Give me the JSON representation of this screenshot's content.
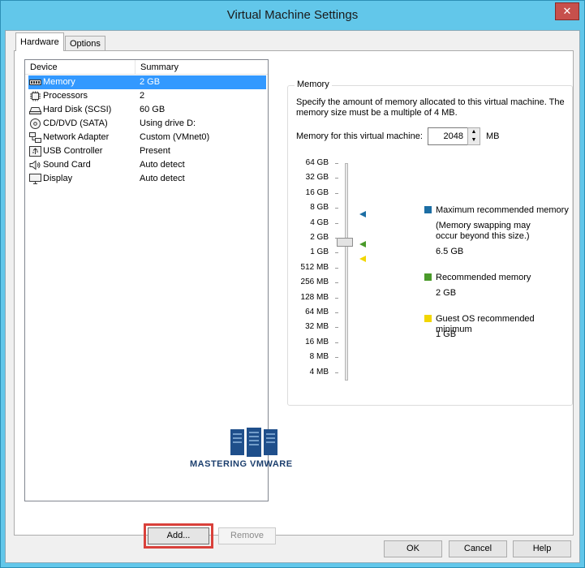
{
  "window": {
    "title": "Virtual Machine Settings",
    "close_label": "✕"
  },
  "tabs": [
    {
      "label": "Hardware",
      "active": true
    },
    {
      "label": "Options",
      "active": false
    }
  ],
  "device_list": {
    "headers": {
      "device": "Device",
      "summary": "Summary"
    },
    "rows": [
      {
        "icon": "memory-icon",
        "device": "Memory",
        "summary": "2 GB",
        "selected": true
      },
      {
        "icon": "processor-icon",
        "device": "Processors",
        "summary": "2"
      },
      {
        "icon": "hard-disk-icon",
        "device": "Hard Disk (SCSI)",
        "summary": "60 GB"
      },
      {
        "icon": "cd-dvd-icon",
        "device": "CD/DVD (SATA)",
        "summary": "Using drive D:"
      },
      {
        "icon": "network-adapter-icon",
        "device": "Network Adapter",
        "summary": "Custom (VMnet0)"
      },
      {
        "icon": "usb-controller-icon",
        "device": "USB Controller",
        "summary": "Present"
      },
      {
        "icon": "sound-card-icon",
        "device": "Sound Card",
        "summary": "Auto detect"
      },
      {
        "icon": "display-icon",
        "device": "Display",
        "summary": "Auto detect"
      }
    ]
  },
  "buttons": {
    "add": "Add...",
    "remove": "Remove",
    "ok": "OK",
    "cancel": "Cancel",
    "help": "Help"
  },
  "memory": {
    "group_title": "Memory",
    "description": "Specify the amount of memory allocated to this virtual machine. The memory size must be a multiple of 4 MB.",
    "for_label": "Memory for this virtual machine:",
    "value": "2048",
    "unit": "MB",
    "scale": [
      "64 GB",
      "32 GB",
      "16 GB",
      "8 GB",
      "4 GB",
      "2 GB",
      "1 GB",
      "512 MB",
      "256 MB",
      "128 MB",
      "64 MB",
      "32 MB",
      "16 MB",
      "8 MB",
      "4 MB"
    ],
    "legend": {
      "max_title": "Maximum recommended memory",
      "max_note": "(Memory swapping may occur beyond this size.)",
      "max_value": "6.5 GB",
      "rec_title": "Recommended memory",
      "rec_value": "2 GB",
      "guest_title": "Guest OS recommended minimum",
      "guest_value": "1 GB"
    },
    "colors": {
      "max": "#1c6ea4",
      "recommended": "#4a9a2a",
      "guest_min": "#f2d600"
    }
  },
  "watermark": {
    "text": "MASTERING VMWARE"
  }
}
